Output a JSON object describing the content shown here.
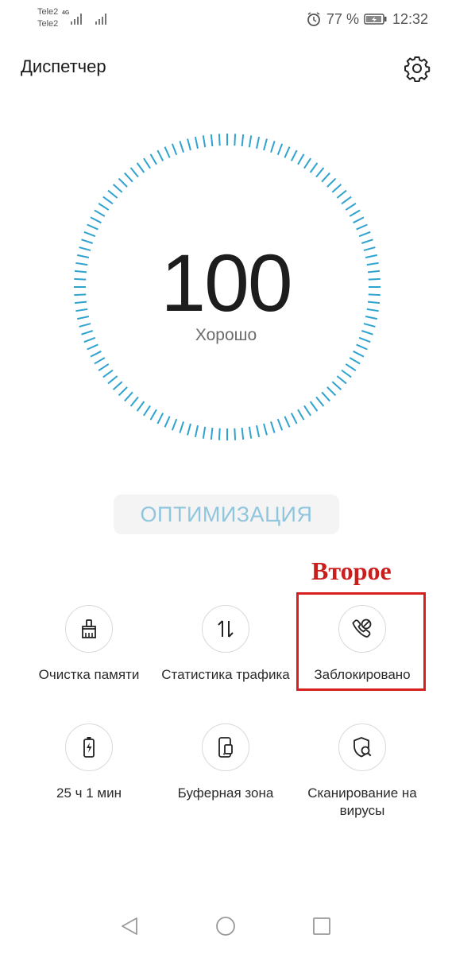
{
  "status_bar": {
    "carrier_1": "Tele2",
    "carrier_2": "Tele2",
    "network_type": "4G",
    "alarm_icon": "alarm-icon",
    "battery_percent": "77 %",
    "battery_icon": "battery-charging-icon",
    "time": "12:32"
  },
  "header": {
    "title": "Диспетчер",
    "settings_icon": "gear-icon"
  },
  "score": {
    "value": "100",
    "label": "Хорошо",
    "accent_color": "#2fa3cf"
  },
  "optimize_button": {
    "label": "ОПТИМИЗАЦИЯ"
  },
  "annotation": {
    "text": "Второе",
    "color": "#d71f1f"
  },
  "tools": [
    {
      "label": "Очистка памяти",
      "icon": "broom-icon"
    },
    {
      "label": "Статистика трафика",
      "icon": "traffic-arrows-icon"
    },
    {
      "label": "Заблокировано",
      "icon": "blocked-call-icon"
    },
    {
      "label": "25 ч 1 мин",
      "icon": "battery-icon"
    },
    {
      "label": "Буферная зона",
      "icon": "phone-buffer-icon"
    },
    {
      "label": "Сканирование на вирусы",
      "icon": "shield-search-icon"
    }
  ],
  "nav_bar": {
    "back_icon": "back-triangle-icon",
    "home_icon": "home-circle-icon",
    "recents_icon": "recents-square-icon"
  }
}
